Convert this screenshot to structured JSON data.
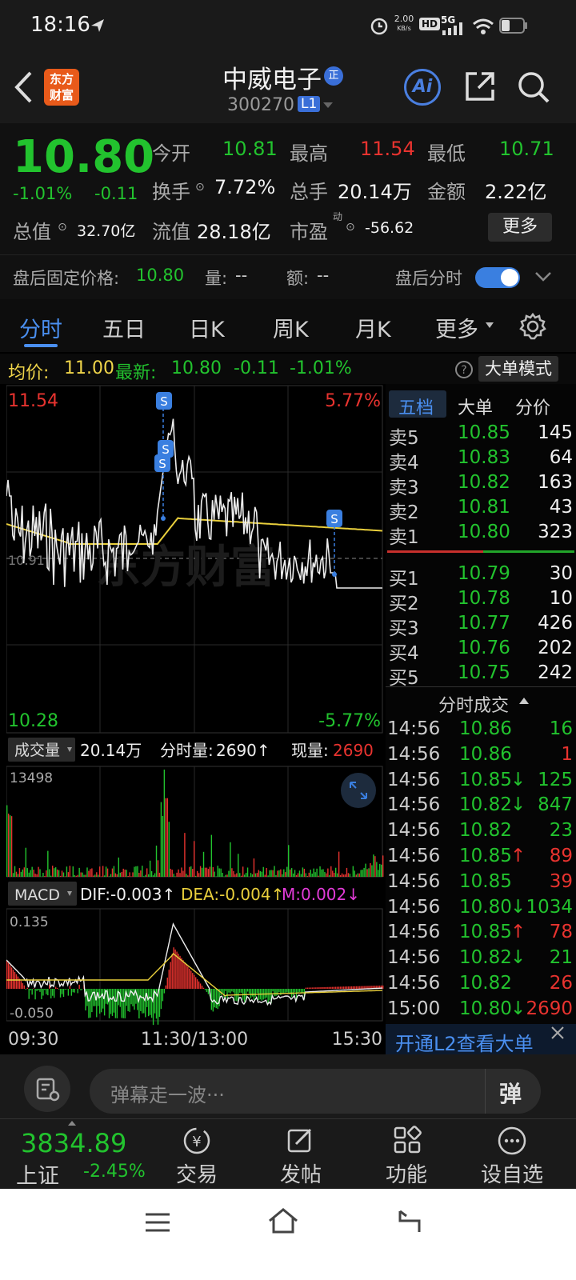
{
  "status_bar": {
    "time": "18:16",
    "speed": "2.00",
    "speed_unit": "KB/s",
    "hd": "HD",
    "net": "5G"
  },
  "header": {
    "logo_line1": "东方",
    "logo_line2": "财富",
    "title": "中威电子",
    "badge": "正",
    "code": "300270",
    "level": "L1",
    "ai": "Ai"
  },
  "quote": {
    "price": "10.80",
    "change_pct": "-1.01%",
    "change": "-0.11",
    "open_label": "今开",
    "open": "10.81",
    "high_label": "最高",
    "high": "11.54",
    "low_label": "最低",
    "low": "10.71",
    "turnover_label": "换手",
    "turnover": "7.72%",
    "volume_label": "总手",
    "volume": "20.14万",
    "amount_label": "金额",
    "amount": "2.22亿",
    "mktcap_label": "总值",
    "mktcap": "32.70亿",
    "float_label": "流值",
    "float": "28.18亿",
    "pe_label": "市盈",
    "pe_sup": "动",
    "pe": "-56.62",
    "more_button": "更多",
    "after_label": "盘后固定价格:",
    "after_price": "10.80",
    "after_vol_label": "量:",
    "after_vol": "--",
    "after_amt_label": "额:",
    "after_amt": "--",
    "after_timeshare": "盘后分时"
  },
  "tabs": [
    "分时",
    "五日",
    "日K",
    "周K",
    "月K",
    "更多"
  ],
  "infoline": {
    "avg_label": "均价:",
    "avg": "11.00",
    "latest_label": "最新:",
    "latest": "10.80",
    "chg": "-0.11",
    "pct": "-1.01%",
    "mode_button": "大单模式"
  },
  "chart": {
    "top_price": "11.54",
    "top_pct": "5.77%",
    "bottom_price": "10.28",
    "bottom_pct": "-5.77%",
    "mid_price": "10.91",
    "s_marker": "S",
    "vol_label": "成交量",
    "vol_total": "20.14万",
    "vol_min_label": "分时量:",
    "vol_min": "2690↑",
    "vol_now_label": "现量:",
    "vol_now": "2690",
    "vol_max": "13498",
    "macd_label": "MACD",
    "dif": "DIF:-0.003↑",
    "dea": "DEA:-0.004↑",
    "m": "M:0.002↓",
    "macd_top": "0.135",
    "macd_bottom": "-0.050",
    "time_start": "09:30",
    "time_mid": "11:30/13:00",
    "time_end": "15:30",
    "watermark": "东方财富"
  },
  "orderbook": {
    "tabs": [
      "五档",
      "大单",
      "分价"
    ],
    "asks": [
      [
        "卖5",
        "10.85",
        "145"
      ],
      [
        "卖4",
        "10.83",
        "64"
      ],
      [
        "卖3",
        "10.82",
        "163"
      ],
      [
        "卖2",
        "10.81",
        "43"
      ],
      [
        "卖1",
        "10.80",
        "323"
      ]
    ],
    "bids": [
      [
        "买1",
        "10.79",
        "30"
      ],
      [
        "买2",
        "10.78",
        "10"
      ],
      [
        "买3",
        "10.77",
        "426"
      ],
      [
        "买4",
        "10.76",
        "202"
      ],
      [
        "买5",
        "10.75",
        "242"
      ]
    ],
    "trades_title": "分时成交",
    "trades": [
      [
        "14:56",
        "10.86",
        "",
        "16",
        "green"
      ],
      [
        "14:56",
        "10.86",
        "",
        "1",
        "red"
      ],
      [
        "14:56",
        "10.85",
        "↓",
        "125",
        "green"
      ],
      [
        "14:56",
        "10.82",
        "↓",
        "847",
        "green"
      ],
      [
        "14:56",
        "10.82",
        "",
        "23",
        "green"
      ],
      [
        "14:56",
        "10.85",
        "↑",
        "89",
        "red"
      ],
      [
        "14:56",
        "10.85",
        "",
        "39",
        "red"
      ],
      [
        "14:56",
        "10.80",
        "↓",
        "1034",
        "green"
      ],
      [
        "14:56",
        "10.85",
        "↑",
        "78",
        "red"
      ],
      [
        "14:56",
        "10.82",
        "↓",
        "21",
        "green"
      ],
      [
        "14:56",
        "10.82",
        "",
        "26",
        "red"
      ],
      [
        "15:00",
        "10.80",
        "↓",
        "2690",
        "red"
      ]
    ],
    "l2_banner": "开通L2查看大单"
  },
  "comment": {
    "placeholder": "弹幕走一波···",
    "danmu": "弹"
  },
  "bottom_nav": {
    "index_value": "3834.89",
    "index_name": "上证",
    "index_pct": "-2.45%",
    "items": [
      "交易",
      "发帖",
      "功能",
      "设自选"
    ],
    "trade_glyph": "¥"
  }
}
